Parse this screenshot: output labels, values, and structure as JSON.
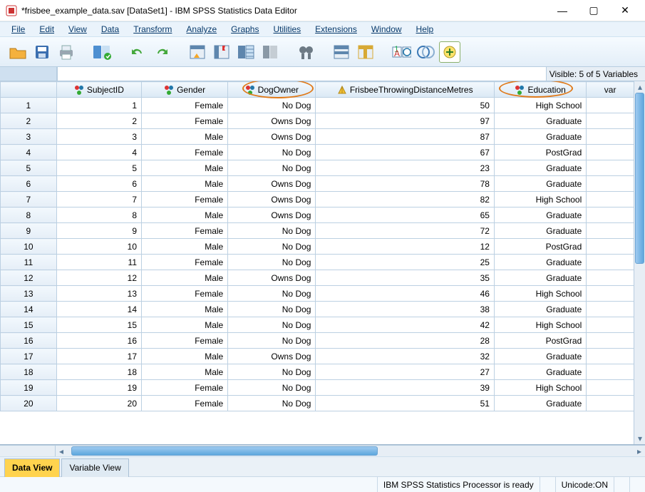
{
  "window": {
    "title": "*frisbee_example_data.sav [DataSet1] - IBM SPSS Statistics Data Editor",
    "minimize": "—",
    "maximize": "▢",
    "close": "✕"
  },
  "menubar": [
    "File",
    "Edit",
    "View",
    "Data",
    "Transform",
    "Analyze",
    "Graphs",
    "Utilities",
    "Extensions",
    "Window",
    "Help"
  ],
  "strip": {
    "visible_label": "Visible: 5 of 5 Variables"
  },
  "columns": {
    "subject": "SubjectID",
    "gender": "Gender",
    "dog": "DogOwner",
    "frisbee": "FrisbeeThrowingDistanceMetres",
    "edu": "Education",
    "var": "var"
  },
  "rows": [
    {
      "n": "1",
      "id": "1",
      "gender": "Female",
      "dog": "No Dog",
      "dist": "50",
      "edu": "High School"
    },
    {
      "n": "2",
      "id": "2",
      "gender": "Female",
      "dog": "Owns Dog",
      "dist": "97",
      "edu": "Graduate"
    },
    {
      "n": "3",
      "id": "3",
      "gender": "Male",
      "dog": "Owns Dog",
      "dist": "87",
      "edu": "Graduate"
    },
    {
      "n": "4",
      "id": "4",
      "gender": "Female",
      "dog": "No Dog",
      "dist": "67",
      "edu": "PostGrad"
    },
    {
      "n": "5",
      "id": "5",
      "gender": "Male",
      "dog": "No Dog",
      "dist": "23",
      "edu": "Graduate"
    },
    {
      "n": "6",
      "id": "6",
      "gender": "Male",
      "dog": "Owns Dog",
      "dist": "78",
      "edu": "Graduate"
    },
    {
      "n": "7",
      "id": "7",
      "gender": "Female",
      "dog": "Owns Dog",
      "dist": "82",
      "edu": "High School"
    },
    {
      "n": "8",
      "id": "8",
      "gender": "Male",
      "dog": "Owns Dog",
      "dist": "65",
      "edu": "Graduate"
    },
    {
      "n": "9",
      "id": "9",
      "gender": "Female",
      "dog": "No Dog",
      "dist": "72",
      "edu": "Graduate"
    },
    {
      "n": "10",
      "id": "10",
      "gender": "Male",
      "dog": "No Dog",
      "dist": "12",
      "edu": "PostGrad"
    },
    {
      "n": "11",
      "id": "11",
      "gender": "Female",
      "dog": "No Dog",
      "dist": "25",
      "edu": "Graduate"
    },
    {
      "n": "12",
      "id": "12",
      "gender": "Male",
      "dog": "Owns Dog",
      "dist": "35",
      "edu": "Graduate"
    },
    {
      "n": "13",
      "id": "13",
      "gender": "Female",
      "dog": "No Dog",
      "dist": "46",
      "edu": "High School"
    },
    {
      "n": "14",
      "id": "14",
      "gender": "Male",
      "dog": "No Dog",
      "dist": "38",
      "edu": "Graduate"
    },
    {
      "n": "15",
      "id": "15",
      "gender": "Male",
      "dog": "No Dog",
      "dist": "42",
      "edu": "High School"
    },
    {
      "n": "16",
      "id": "16",
      "gender": "Female",
      "dog": "No Dog",
      "dist": "28",
      "edu": "PostGrad"
    },
    {
      "n": "17",
      "id": "17",
      "gender": "Male",
      "dog": "Owns Dog",
      "dist": "32",
      "edu": "Graduate"
    },
    {
      "n": "18",
      "id": "18",
      "gender": "Male",
      "dog": "No Dog",
      "dist": "27",
      "edu": "Graduate"
    },
    {
      "n": "19",
      "id": "19",
      "gender": "Female",
      "dog": "No Dog",
      "dist": "39",
      "edu": "High School"
    },
    {
      "n": "20",
      "id": "20",
      "gender": "Female",
      "dog": "No Dog",
      "dist": "51",
      "edu": "Graduate"
    }
  ],
  "tabs": {
    "data_view": "Data View",
    "variable_view": "Variable View"
  },
  "status": {
    "processor": "IBM SPSS Statistics Processor is ready",
    "unicode": "Unicode:ON"
  }
}
